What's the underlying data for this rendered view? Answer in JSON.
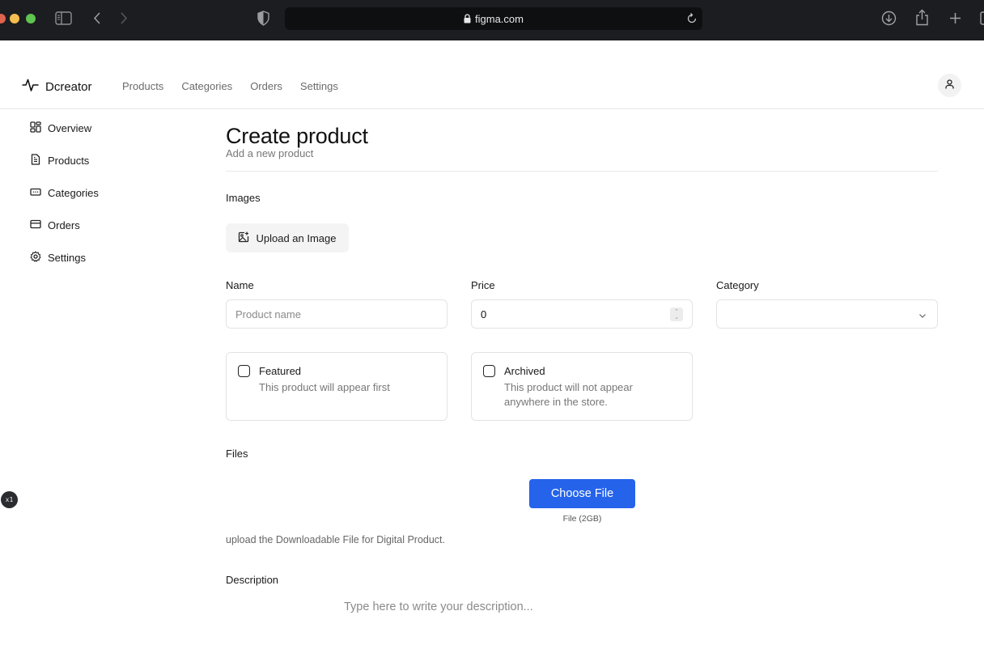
{
  "browser": {
    "url": "figma.com",
    "icons": [
      "sidebar-toggle-icon",
      "back-icon",
      "forward-icon",
      "shield-icon",
      "lock-icon",
      "reload-icon",
      "download-icon",
      "share-icon",
      "new-tab-icon",
      "tabs-overview-icon"
    ]
  },
  "header": {
    "brand": "Dcreator",
    "nav": [
      "Products",
      "Categories",
      "Orders",
      "Settings"
    ]
  },
  "sidebar": {
    "items": [
      {
        "label": "Overview",
        "icon": "grid-icon"
      },
      {
        "label": "Products",
        "icon": "file-icon"
      },
      {
        "label": "Categories",
        "icon": "keyboard-icon"
      },
      {
        "label": "Orders",
        "icon": "credit-card-icon"
      },
      {
        "label": "Settings",
        "icon": "gear-icon"
      }
    ]
  },
  "page": {
    "title": "Create product",
    "subtitle": "Add a new product"
  },
  "images": {
    "label": "Images",
    "upload_label": "Upload an Image"
  },
  "form": {
    "name": {
      "label": "Name",
      "placeholder": "Product name",
      "value": ""
    },
    "price": {
      "label": "Price",
      "value": "0"
    },
    "category": {
      "label": "Category",
      "value": ""
    },
    "featured": {
      "title": "Featured",
      "description": "This product will appear first",
      "checked": false
    },
    "archived": {
      "title": "Archived",
      "description_line1": "This product will not appear",
      "description_line2": "anywhere in the store.",
      "checked": false
    }
  },
  "files": {
    "label": "Files",
    "button_label": "Choose File",
    "size_hint": "File (2GB)",
    "help": "upload the Downloadable File for Digital Product."
  },
  "description": {
    "label": "Description",
    "placeholder": "Type here to write your description..."
  },
  "overlay": {
    "badge": "x1"
  },
  "colors": {
    "primary": "#2563eb",
    "chrome_bg": "#1b1d20"
  }
}
